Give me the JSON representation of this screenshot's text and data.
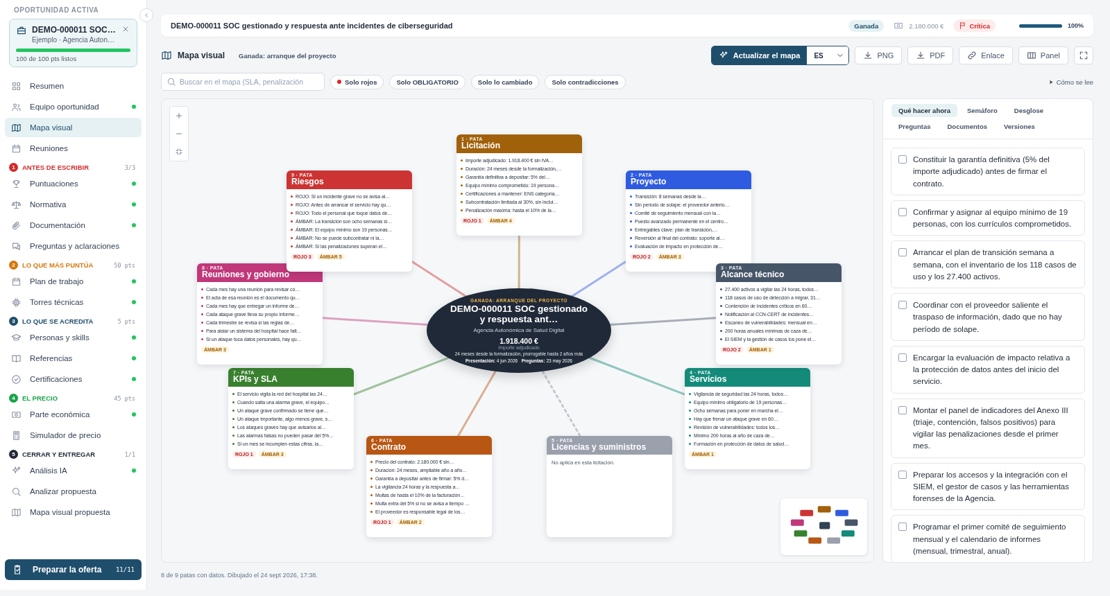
{
  "sidebar": {
    "heading": "OPORTUNIDAD ACTIVA",
    "opportunity": {
      "title": "DEMO-000011 SOC…",
      "subtitle": "Ejemplo · Agencia Auton…",
      "level": 1,
      "progress_text": "100 de 100 pts listos"
    },
    "nav": [
      {
        "label": "Resumen",
        "done": false,
        "selected": false
      },
      {
        "label": "Equipo oportunidad",
        "done": true,
        "selected": false
      },
      {
        "label": "Mapa visual",
        "done": false,
        "selected": true
      },
      {
        "label": "Reuniones",
        "done": false,
        "selected": false
      }
    ],
    "sections": [
      {
        "number": "1",
        "title": "ANTES DE ESCRIBIR",
        "count": "3/3",
        "color": "#d42a2a",
        "items": [
          {
            "label": "Puntuaciones",
            "done": true,
            "selected": false
          },
          {
            "label": "Normativa",
            "done": true,
            "selected": false
          },
          {
            "label": "Documentación",
            "done": true,
            "selected": false
          },
          {
            "label": "Preguntas y aclaraciones",
            "done": false,
            "selected": false
          }
        ]
      },
      {
        "number": "2",
        "title": "LO QUE MÁS PUNTÚA",
        "count": "50 pts",
        "color": "#d9770f",
        "items": [
          {
            "label": "Plan de trabajo",
            "done": true,
            "selected": false
          },
          {
            "label": "Torres técnicas",
            "done": true,
            "selected": false
          }
        ]
      },
      {
        "number": "3",
        "title": "LO QUE SE ACREDITA",
        "count": "5 pts",
        "color": "#1e4e6b",
        "items": [
          {
            "label": "Personas y skills",
            "done": true,
            "selected": false
          },
          {
            "label": "Referencias",
            "done": true,
            "selected": false
          },
          {
            "label": "Certificaciones",
            "done": true,
            "selected": false
          }
        ]
      },
      {
        "number": "4",
        "title": "EL PRECIO",
        "count": "45 pts",
        "color": "#16a34a",
        "items": [
          {
            "label": "Parte económica",
            "done": true,
            "selected": false
          },
          {
            "label": "Simulador de precio",
            "done": false,
            "selected": false
          }
        ]
      },
      {
        "number": "5",
        "title": "CERRAR Y ENTREGAR",
        "count": "1/1",
        "color": "#1f2937",
        "items": [
          {
            "label": "Análisis IA",
            "done": true,
            "selected": false
          },
          {
            "label": "Analizar propuesta",
            "done": false,
            "selected": false
          },
          {
            "label": "Mapa visual propuesta",
            "done": false,
            "selected": false
          }
        ]
      }
    ],
    "cta": {
      "label": "Preparar la oferta",
      "count": "11/11"
    }
  },
  "header": {
    "title": "DEMO-000011 SOC gestionado y respuesta ante incidentes de ciberseguridad",
    "status": "Ganada",
    "amount": "2.180.000 €",
    "priority": "Crítica",
    "level": 1,
    "percent": "100%"
  },
  "toolbar": {
    "title": "Mapa visual",
    "subtitle": "Ganada: arranque del proyecto",
    "update_button": "Actualizar el mapa",
    "language": "ES",
    "buttons": [
      "PNG",
      "PDF",
      "Enlace",
      "Panel"
    ]
  },
  "filters": {
    "search": {
      "placeholder": "Buscar en el mapa (SLA, penalización"
    },
    "chips": [
      {
        "label": "Solo rojos",
        "kind": "dot"
      },
      {
        "label": "Solo OBLIGATORIO",
        "kind": "plain"
      },
      {
        "label": "Solo lo cambiado",
        "kind": "plain"
      },
      {
        "label": "Solo contradicciones",
        "kind": "plain"
      }
    ],
    "help": "Cómo se lee"
  },
  "map": {
    "center": {
      "eyebrow": "GANADA: ARRANQUE DEL PROYECTO",
      "title": "DEMO-000011 SOC gestionado y respuesta ant…",
      "client": "Agencia Autonómica de Salud Digital",
      "amount": "1.918.400 €",
      "amount_label": "Importe adjudicado",
      "duration": "24 meses desde la formalización, prorrogable hasta 2 años más",
      "dates": "**Presentación:** 4 jun 2026   **Preguntas:** 23 may 2026"
    },
    "cards": [
      {
        "eyebrow": "1 · PATA",
        "title": "Licitación",
        "color": "#a0610a",
        "kind": "filled",
        "bullets": [
          "Importe adjudicado: 1.918.400 € sin IVA…",
          "Duración: 24 meses desde la formalización,…",
          "Garantía definitiva a depositar: 5% del…",
          "Equipo mínimo comprometido: 19 persona…",
          "Certificaciones a mantener: ENS categoría…",
          "Subcontratación limitada al 30%, sin inclui…",
          "Penalización máxima: hasta el 10% de la…"
        ],
        "tags": [
          {
            "label": "ROJO 1",
            "kind": "red"
          },
          {
            "label": "ÁMBAR 4",
            "kind": "amber"
          }
        ]
      },
      {
        "eyebrow": "9 · PATA",
        "title": "Riesgos",
        "color": "#cc3333",
        "kind": "filled",
        "bullets": [
          "ROJO: Si un incidente grave no se avisa al…",
          "ROJO: Antes de arrancar el servicio hay qu…",
          "ROJO: Todo el personal que toque datos de…",
          "ÁMBAR: La transición son ocho semanas si…",
          "ÁMBAR: El equipo mínimo son 19 personas…",
          "ÁMBAR: No se puede subcontratar ni la…",
          "ÁMBAR: Si las penalizaciones superan el…"
        ],
        "tags": [
          {
            "label": "ROJO 3",
            "kind": "red"
          },
          {
            "label": "ÁMBAR 5",
            "kind": "amber"
          }
        ]
      },
      {
        "eyebrow": "2 · PATA",
        "title": "Proyecto",
        "color": "#2f5be0",
        "kind": "filled",
        "bullets": [
          "Transición: 8 semanas desde la…",
          "Sin periodo de solape: el proveedor anterio…",
          "Comité de seguimiento mensual con la…",
          "Puesto avanzado permanente en el centro…",
          "Entregables clave: plan de transición,…",
          "Reversión al final del contrato: soporte al…",
          "Evaluación de impacto en protección de…"
        ],
        "tags": [
          {
            "label": "ROJO 2",
            "kind": "red"
          },
          {
            "label": "ÁMBAR 3",
            "kind": "amber"
          }
        ]
      },
      {
        "eyebrow": "8 · PATA",
        "title": "Reuniones y gobierno",
        "color": "#c0377a",
        "kind": "filled",
        "bullets": [
          "Cada mes hay una reunión para revisar có…",
          "El acta de esa reunión es el documento qu…",
          "Cada mes hay que entregar un informe de…",
          "Cada ataque grave lleva su propio informe…",
          "Cada trimestre se revisa si las reglas de…",
          "Para aislar un sistema del hospital hace falt…",
          "Si un ataque toca datos personales, hay qu…"
        ],
        "tags": [
          {
            "label": "ÁMBAR 3",
            "kind": "amber"
          }
        ]
      },
      {
        "eyebrow": "3 · PATA",
        "title": "Alcance técnico",
        "color": "#475569",
        "kind": "filled",
        "bullets": [
          "27.400 activos a vigilar las 24 horas, todos…",
          "118 casos de uso de detección a migrar, 31…",
          "Contención de incidentes críticos en 60…",
          "Notificación al CCN-CERT de incidentes…",
          "Escaneo de vulnerabilidades: mensual en…",
          "200 horas anuales mínimas de caza de…",
          "El SIEM y la gestión de casos los pone el…"
        ],
        "tags": [
          {
            "label": "ROJO 2",
            "kind": "red"
          },
          {
            "label": "ÁMBAR 1",
            "kind": "amber"
          }
        ]
      },
      {
        "eyebrow": "7 · PATA",
        "title": "KPIs y SLA",
        "color": "#38802e",
        "kind": "filled",
        "bullets": [
          "El servicio vigila la red del hospital las 24…",
          "Cuando salta una alarma grave, el equipo…",
          "Un ataque grave confirmado se tiene que…",
          "Un ataque importante, algo menos grave, s…",
          "Los ataques graves hay que avisarlos al…",
          "Las alarmas falsas no pueden pasar del 5%…",
          "Si un mes se incumplen estas cifras, la…"
        ],
        "tags": [
          {
            "label": "ROJO 1",
            "kind": "red"
          },
          {
            "label": "ÁMBAR 3",
            "kind": "amber"
          }
        ]
      },
      {
        "eyebrow": "4 · PATA",
        "title": "Servicios",
        "color": "#138a7a",
        "kind": "filled",
        "bullets": [
          "Vigilancia de seguridad las 24 horas, todos…",
          "Equipo mínimo obligatorio de 19 personas…",
          "Ocho semanas para poner en marcha el…",
          "Hay que frenar un ataque grave en 60…",
          "Revisión de vulnerabilidades: todos los…",
          "Mínimo 200 horas al año de caza de…",
          "Formación en protección de datos de salud…"
        ],
        "tags": [
          {
            "label": "ÁMBAR 1",
            "kind": "amber"
          }
        ]
      },
      {
        "eyebrow": "6 · PATA",
        "title": "Contrato",
        "color": "#b85713",
        "kind": "filled",
        "bullets": [
          "Precio del contrato: 2.180.000 € sin…",
          "Duración: 24 meses, ampliable año a año…",
          "Garantía a depositar antes de firmar: 5% d…",
          "La vigilancia 24 horas y la respuesta a…",
          "Multas de hasta el 10% de la facturación…",
          "Multa extra del 5% si no se avisa a tiempo …",
          "El proveedor es responsable legal de los…"
        ],
        "tags": [
          {
            "label": "ROJO 1",
            "kind": "red"
          },
          {
            "label": "ÁMBAR 2",
            "kind": "amber"
          }
        ]
      },
      {
        "eyebrow": "5 · PATA",
        "title": "Licencias y suministros",
        "color": "#9aa1ad",
        "kind": "empty",
        "note": "No aplica en esta licitación."
      }
    ]
  },
  "panel": {
    "tabs": [
      {
        "label": "Qué hacer ahora",
        "selected": true
      },
      {
        "label": "Semáforo",
        "selected": false
      },
      {
        "label": "Desglose",
        "selected": false
      },
      {
        "label": "Preguntas",
        "selected": false
      },
      {
        "label": "Documentos",
        "selected": false
      },
      {
        "label": "Versiones",
        "selected": false
      }
    ],
    "tasks": [
      {
        "text": "Constituir la garantía definitiva (5% del importe adjudicado) antes de firmar el contrato.",
        "checked": false
      },
      {
        "text": "Confirmar y asignar al equipo mínimo de 19 personas, con los currículos comprometidos.",
        "checked": false
      },
      {
        "text": "Arrancar el plan de transición semana a semana, con el inventario de los 118 casos de uso y los 27.400 activos.",
        "checked": false
      },
      {
        "text": "Coordinar con el proveedor saliente el traspaso de información, dado que no hay período de solape.",
        "checked": false
      },
      {
        "text": "Encargar la evaluación de impacto relativa a la protección de datos antes del inicio del servicio.",
        "checked": false
      },
      {
        "text": "Montar el panel de indicadores del Anexo III (triaje, contención, falsos positivos) para vigilar las penalizaciones desde el primer mes.",
        "checked": false
      },
      {
        "text": "Preparar los accesos y la integración con el SIEM, el gestor de casos y las herramientas forenses de la Agencia.",
        "checked": false
      },
      {
        "text": "Programar el primer comité de seguimiento mensual y el calendario de informes (mensual, trimestral, anual).",
        "checked": false
      }
    ]
  },
  "footer": "8 de 9 patas con datos. Dibujado el 24 sept 2026, 17:38."
}
